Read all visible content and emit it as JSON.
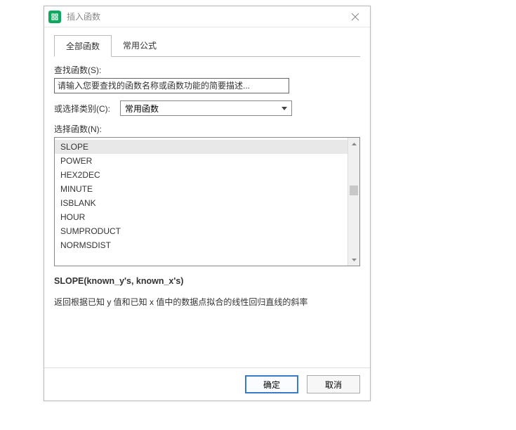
{
  "titlebar": {
    "title": "插入函数"
  },
  "tabs": {
    "all_functions": "全部函数",
    "common_formulas": "常用公式"
  },
  "search": {
    "label": "查找函数(S):",
    "placeholder": "请输入您要查找的函数名称或函数功能的简要描述..."
  },
  "category": {
    "label": "或选择类别(C):",
    "selected": "常用函数"
  },
  "select_function": {
    "label": "选择函数(N):"
  },
  "functions": [
    "SLOPE",
    "POWER",
    "HEX2DEC",
    "MINUTE",
    "ISBLANK",
    "HOUR",
    "SUMPRODUCT",
    "NORMSDIST"
  ],
  "signature": "SLOPE(known_y's, known_x's)",
  "description": "返回根据已知 y 值和已知 x 值中的数据点拟合的线性回归直线的斜率",
  "footer": {
    "ok": "确定",
    "cancel": "取消"
  }
}
